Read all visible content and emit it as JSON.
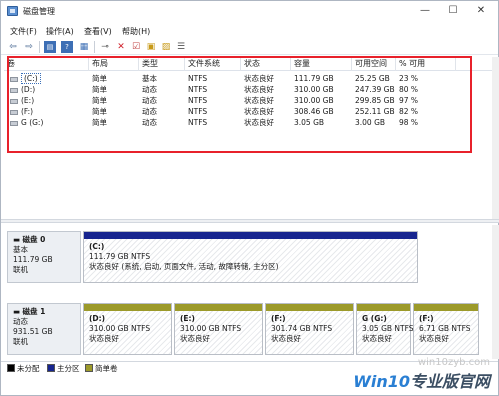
{
  "window": {
    "title": "磁盘管理"
  },
  "controls": {
    "min": "—",
    "max": "☐",
    "close": "✕"
  },
  "menu": [
    "文件(F)",
    "操作(A)",
    "查看(V)",
    "帮助(H)"
  ],
  "toolbar": [
    "back-icon",
    "forward-icon",
    "console-icon",
    "help-icon",
    "properties-icon",
    "connect-icon",
    "delete-icon",
    "check-icon",
    "new-icon",
    "open-icon",
    "list-icon"
  ],
  "columns": [
    "卷",
    "布局",
    "类型",
    "文件系统",
    "状态",
    "容量",
    "可用空间",
    "% 可用"
  ],
  "volumes": [
    {
      "name": "(C:)",
      "layout": "简单",
      "type": "基本",
      "fs": "NTFS",
      "status": "状态良好",
      "capacity": "111.79 GB",
      "free": "25.25 GB",
      "pct": "23 %"
    },
    {
      "name": "(D:)",
      "layout": "简单",
      "type": "动态",
      "fs": "NTFS",
      "status": "状态良好",
      "capacity": "310.00 GB",
      "free": "247.39 GB",
      "pct": "80 %"
    },
    {
      "name": "(E:)",
      "layout": "简单",
      "type": "动态",
      "fs": "NTFS",
      "status": "状态良好",
      "capacity": "310.00 GB",
      "free": "299.85 GB",
      "pct": "97 %"
    },
    {
      "name": "(F:)",
      "layout": "简单",
      "type": "动态",
      "fs": "NTFS",
      "status": "状态良好",
      "capacity": "308.46 GB",
      "free": "252.11 GB",
      "pct": "82 %"
    },
    {
      "name": "G (G:)",
      "layout": "简单",
      "type": "动态",
      "fs": "NTFS",
      "status": "状态良好",
      "capacity": "3.05 GB",
      "free": "3.00 GB",
      "pct": "98 %"
    }
  ],
  "disk0": {
    "name": "磁盘 0",
    "type": "基本",
    "size": "111.79 GB",
    "state": "联机",
    "part": {
      "letter": "(C:)",
      "size": "111.79 GB NTFS",
      "status": "状态良好 (系统, 启动, 页面文件, 活动, 故障转储, 主分区)"
    }
  },
  "disk1": {
    "name": "磁盘 1",
    "type": "动态",
    "size": "931.51 GB",
    "state": "联机",
    "parts": [
      {
        "letter": "(D:)",
        "size": "310.00 GB NTFS",
        "status": "状态良好"
      },
      {
        "letter": "(E:)",
        "size": "310.00 GB NTFS",
        "status": "状态良好"
      },
      {
        "letter": "(F:)",
        "size": "301.74 GB NTFS",
        "status": "状态良好"
      },
      {
        "letter": "G (G:)",
        "size": "3.05 GB NTFS",
        "status": "状态良好"
      },
      {
        "letter": "(F:)",
        "size": "6.71 GB NTFS",
        "status": "状态良好"
      }
    ]
  },
  "legend": [
    {
      "label": "未分配",
      "color": "#000000"
    },
    {
      "label": "主分区",
      "color": "#17258f"
    },
    {
      "label": "简单卷",
      "color": "#9c9a2a"
    }
  ],
  "watermark": {
    "site": "win10zyb.com",
    "brand_a": "Win10",
    "brand_b": "专业版官网"
  }
}
